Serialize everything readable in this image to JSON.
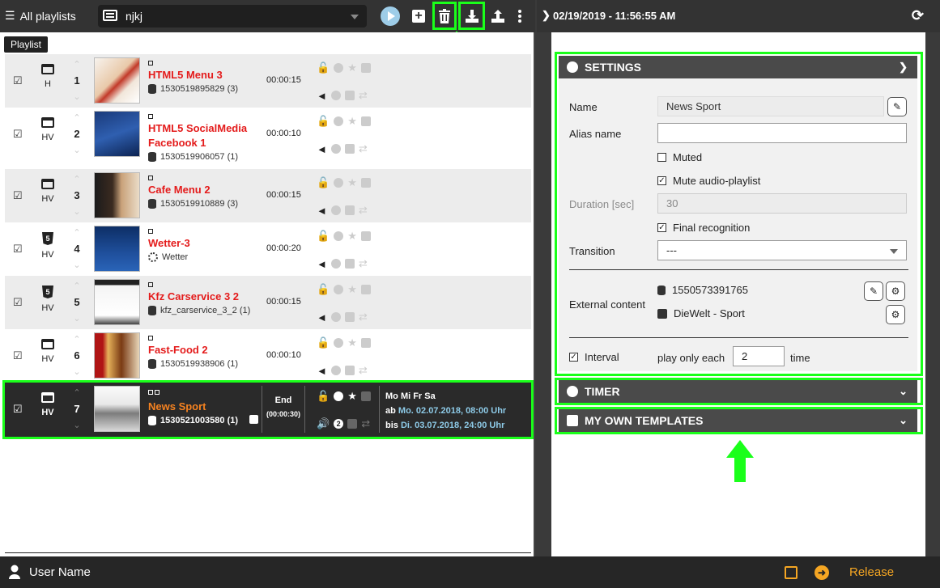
{
  "topbar": {
    "all_playlists": "All playlists",
    "playlist_name": "njkj",
    "tooltip": "Playlist"
  },
  "playlist": {
    "items": [
      {
        "num": "1",
        "type": "H",
        "title": "HTML5 Menu 3",
        "source": "1530519895829 (3)",
        "duration": "00:00:15"
      },
      {
        "num": "2",
        "type": "HV",
        "title": "HTML5 SocialMedia Facebook 1",
        "source": "1530519906057 (1)",
        "duration": "00:00:10"
      },
      {
        "num": "3",
        "type": "HV",
        "title": "Cafe Menu 2",
        "source": "1530519910889 (3)",
        "duration": "00:00:15"
      },
      {
        "num": "4",
        "type": "HV",
        "title": "Wetter-3",
        "source": "Wetter",
        "duration": "00:00:20"
      },
      {
        "num": "5",
        "type": "HV",
        "title": "Kfz Carservice 3 2",
        "source": "kfz_carservice_3_2 (1)",
        "duration": "00:00:15"
      },
      {
        "num": "6",
        "type": "HV",
        "title": "Fast-Food 2",
        "source": "1530519938906 (1)",
        "duration": "00:00:10"
      }
    ],
    "selected": {
      "num": "7",
      "type": "HV",
      "title": "News Sport",
      "source": "1530521003580 (1)",
      "end_label": "End",
      "end_value": "(00:00:30)",
      "volume_badge": "2",
      "days": "Mo Mi Fr Sa",
      "from_prefix": "ab",
      "from_value": "Mo. 02.07.2018, 08:00 Uhr",
      "to_prefix": "bis",
      "to_value": "Di. 03.07.2018, 24:00 Uhr"
    }
  },
  "right": {
    "datetime": "02/19/2019 - 11:56:55 AM",
    "settings": {
      "header": "SETTINGS",
      "name_label": "Name",
      "name_value": "News Sport",
      "alias_label": "Alias name",
      "alias_value": "",
      "muted": "Muted",
      "mute_audio": "Mute audio-playlist",
      "duration_label": "Duration [sec]",
      "duration_value": "30",
      "final_recognition": "Final recognition",
      "transition_label": "Transition",
      "transition_value": "---",
      "external_label": "External content",
      "external_db": "1550573391765",
      "external_rss": "DieWelt - Sport",
      "interval_label": "Interval",
      "interval_text": "play only each",
      "interval_value": "2",
      "interval_unit": "time"
    },
    "timer_header": "TIMER",
    "templates_header": "MY OWN TEMPLATES"
  },
  "bottombar": {
    "user_name": "User Name",
    "release": "Release"
  },
  "colors": {
    "highlight": "#1aff1a",
    "title_red": "#e41b1b",
    "accent_orange": "#f58220",
    "release_orange": "#f5a623"
  }
}
